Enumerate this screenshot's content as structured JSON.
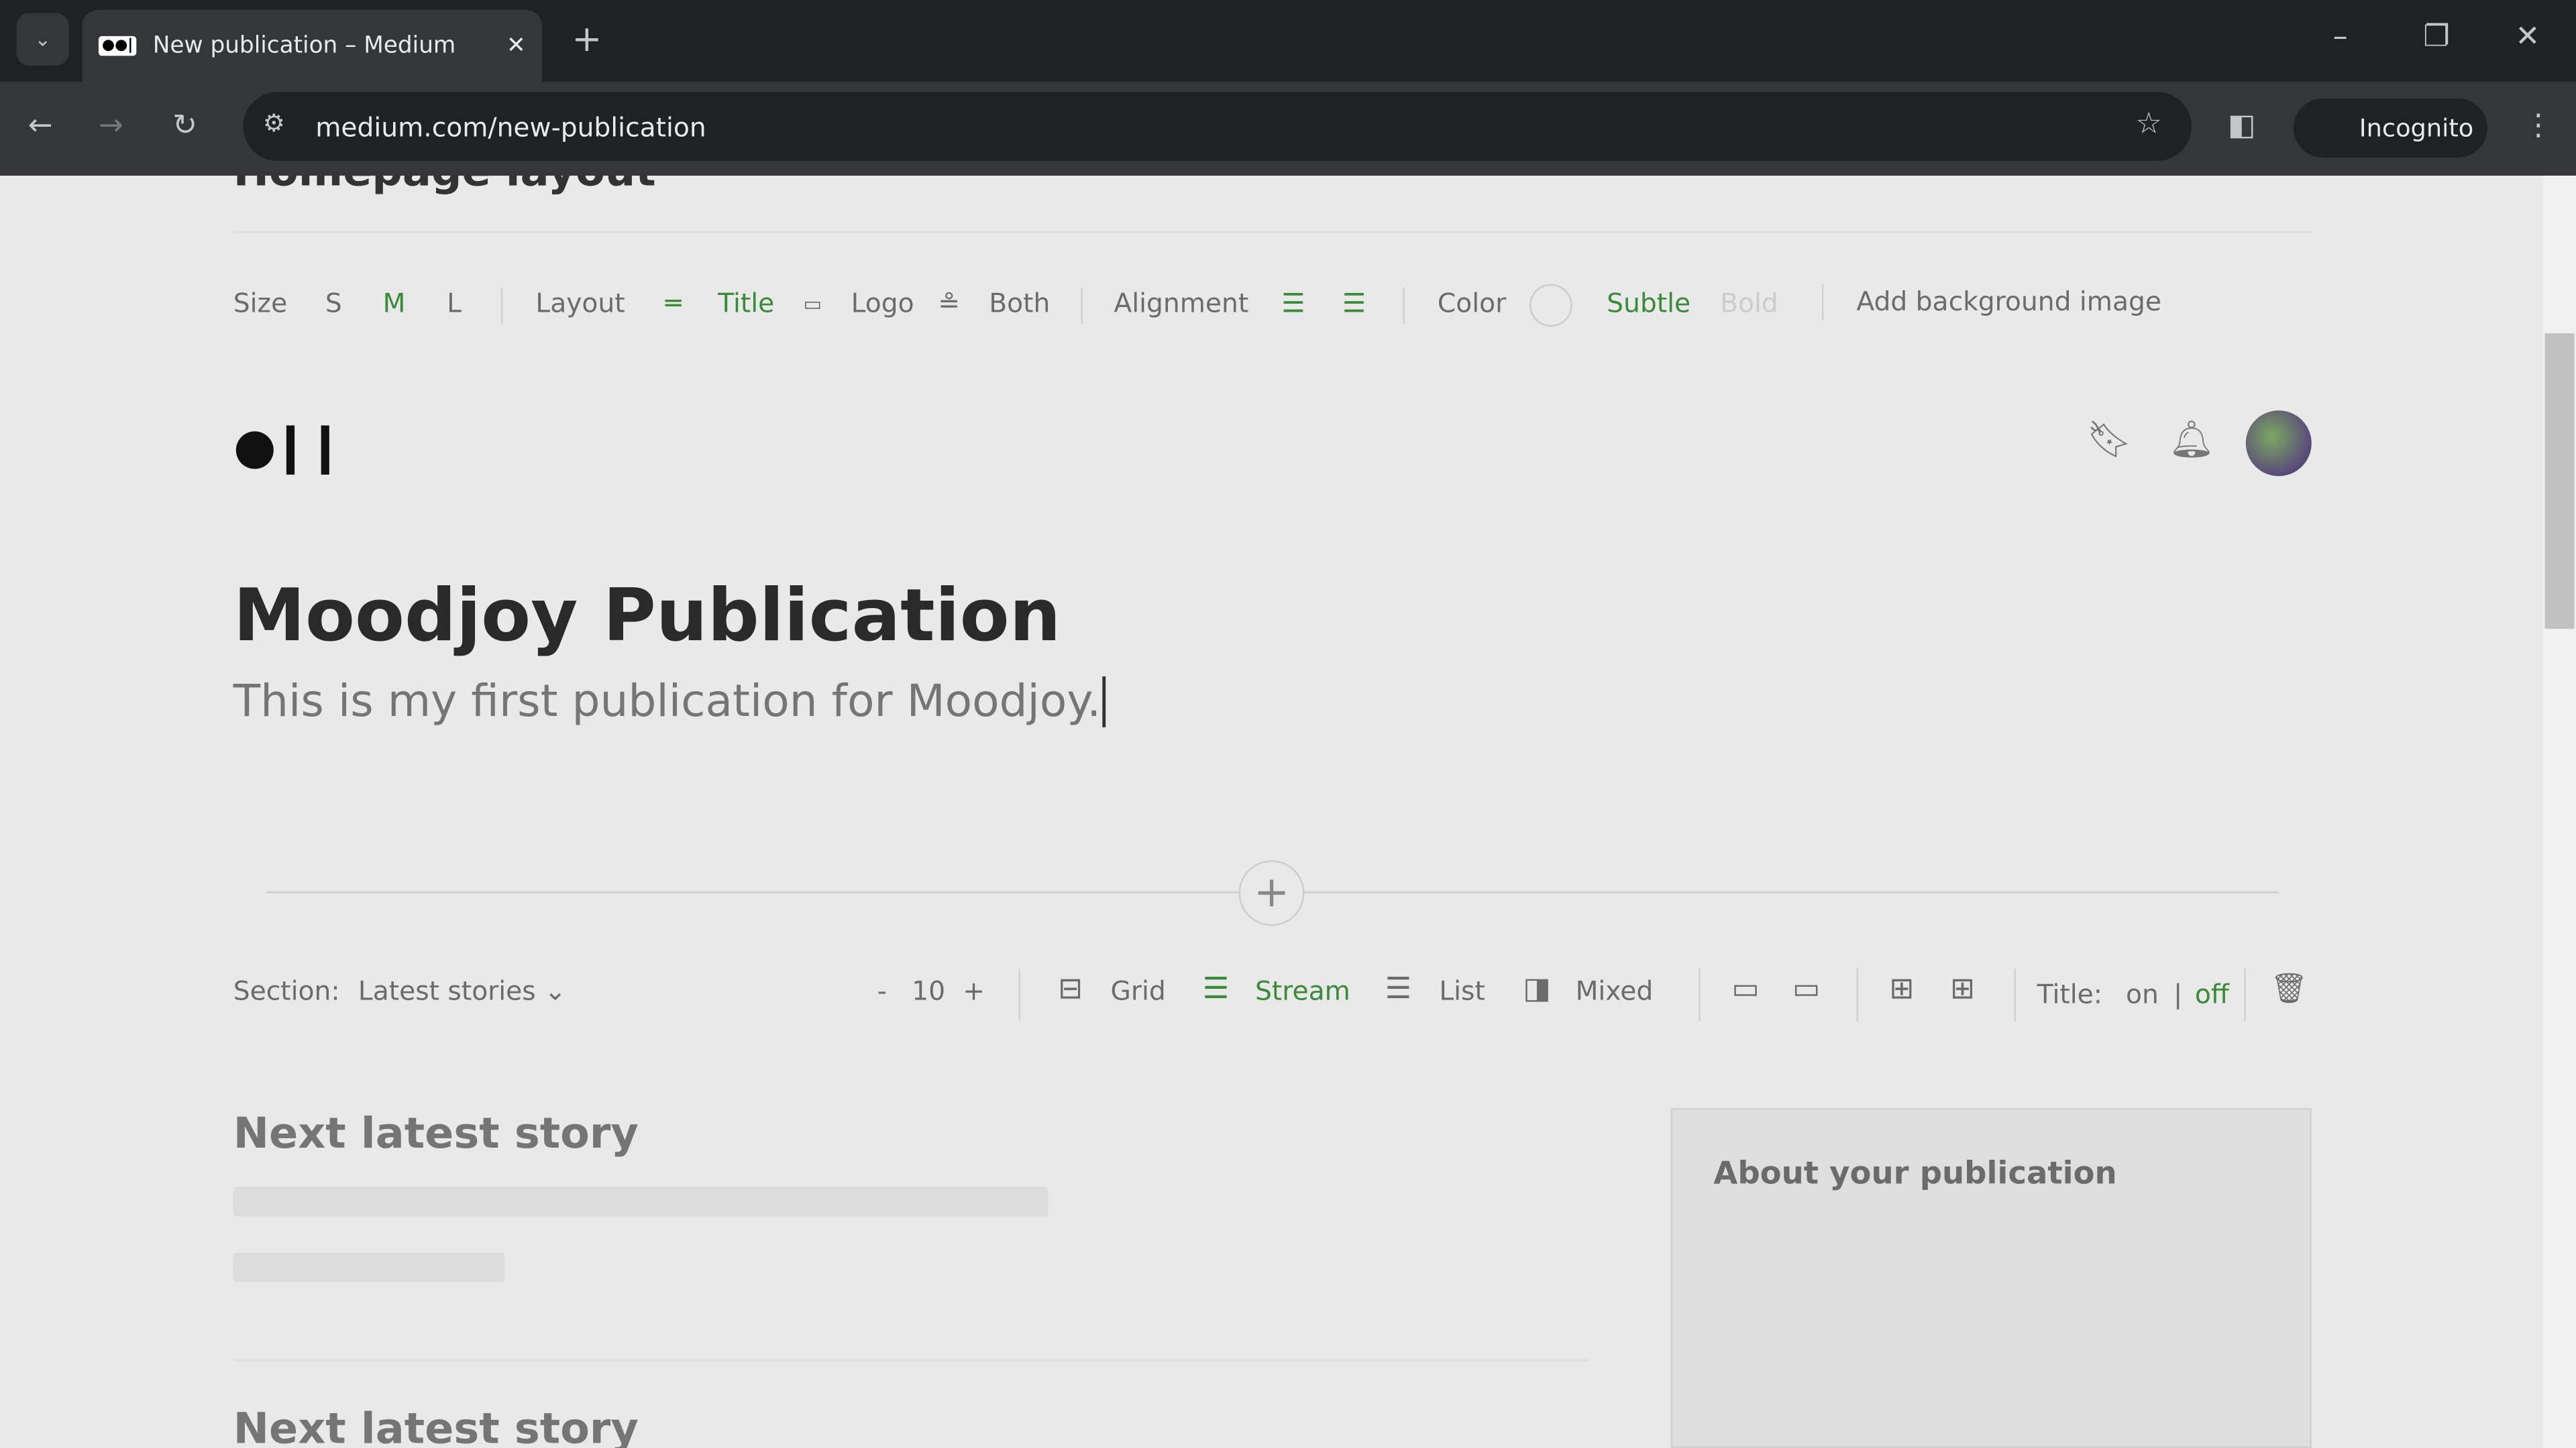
{
  "browser": {
    "tab_title": "New publication – Medium",
    "url": "medium.com/new-publication",
    "profile": "Incognito"
  },
  "heading_partial": "Homepage layout",
  "toolbar": {
    "size_label": "Size",
    "sizes": [
      "S",
      "M",
      "L"
    ],
    "layout_label": "Layout",
    "layouts": [
      "Title",
      "Logo",
      "Both"
    ],
    "alignment_label": "Alignment",
    "color_label": "Color",
    "color_options": [
      "Subtle",
      "Bold"
    ],
    "add_bg": "Add background image"
  },
  "publication": {
    "title": "Moodjoy Publication",
    "description": "This is my first publication for Moodjoy."
  },
  "section": {
    "label": "Section:",
    "value": "Latest stories",
    "count": "10",
    "minus": "-",
    "plus": "+",
    "views": [
      "Grid",
      "Stream",
      "List",
      "Mixed"
    ],
    "title_label": "Title:",
    "title_on": "on",
    "title_sep": "|",
    "title_off": "off"
  },
  "stories": [
    "Next latest story",
    "Next latest story"
  ],
  "sidebar": {
    "title": "About your publication"
  },
  "colors": {
    "accent": "#3a8a3a"
  }
}
